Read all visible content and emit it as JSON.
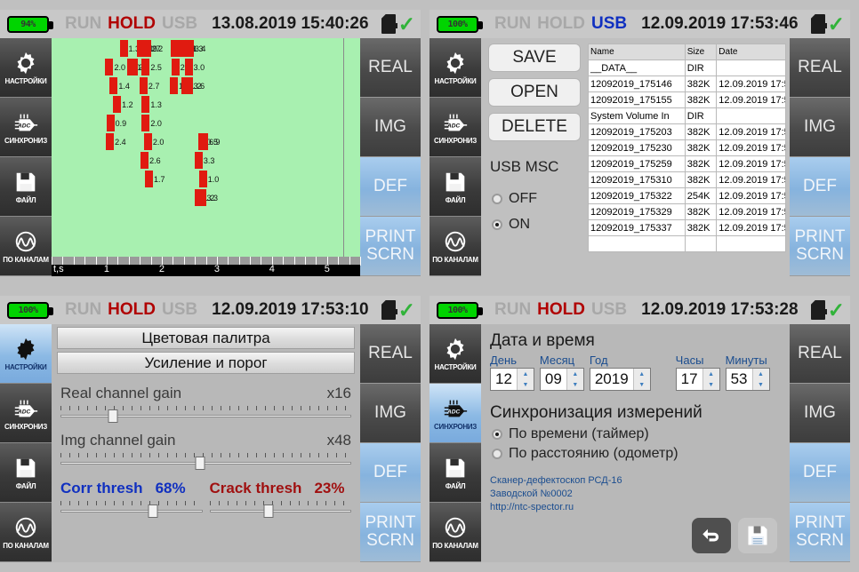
{
  "sidebar_items": [
    {
      "label": "НАСТРОЙКИ",
      "icon": "gear-icon"
    },
    {
      "label": "СИНХРОНИЗ",
      "icon": "adc-icon"
    },
    {
      "label": "ФАЙЛ",
      "icon": "floppy-icon"
    },
    {
      "label": "ПО КАНАЛАМ",
      "icon": "channels-icon"
    }
  ],
  "rail_items": [
    {
      "label": "REAL",
      "style": "dark"
    },
    {
      "label": "IMG",
      "style": "dark"
    },
    {
      "label": "DEF",
      "style": "blue"
    },
    {
      "label": "PRINT SCRN",
      "style": "blue"
    }
  ],
  "colors": {
    "chart_background": "#a8f0b0",
    "bar": "#e01b10",
    "hold": "#b00000",
    "usb": "#1030c0",
    "corr": "#1030c0",
    "crack": "#a01010",
    "battery": "#00d400",
    "check": "#31b33a",
    "active_sidebar": "#8bb9e4"
  },
  "panel1": {
    "header": {
      "battery": "94%",
      "run": "RUN",
      "hold": "HOLD",
      "usb": "USB",
      "datetime": "13.08.2019 15:40:26",
      "sd_icon": "sd-card-icon",
      "status_icon": "check-icon"
    },
    "active_sidebar_index": -1,
    "chart_data": {
      "type": "bar",
      "title": "",
      "xlabel": "t,s",
      "ylabel": "",
      "xlim": [
        0,
        5.6
      ],
      "xticks": [
        1,
        2,
        3,
        4,
        5
      ],
      "grid": false,
      "legend": null,
      "note": "Horizontal red defect-marker bars plotted over time; each bar carries a numeric depth label.",
      "bars": [
        {
          "x": 1.04,
          "row": 1,
          "value": "2.0"
        },
        {
          "x": 1.12,
          "row": 2,
          "value": "1.4"
        },
        {
          "x": 1.18,
          "row": 3,
          "value": "1.2"
        },
        {
          "x": 1.06,
          "row": 4,
          "value": "0.9"
        },
        {
          "x": 1.05,
          "row": 5,
          "value": "2.4"
        },
        {
          "x": 1.3,
          "row": 0,
          "value": "1.3"
        },
        {
          "x": 1.43,
          "row": 1,
          "value": "0.3"
        },
        {
          "x": 1.48,
          "row": 1,
          "value": "2.3"
        },
        {
          "x": 1.62,
          "row": 0,
          "value": "1.9"
        },
        {
          "x": 1.68,
          "row": 0,
          "value": "1.7"
        },
        {
          "x": 1.72,
          "row": 0,
          "value": "2.2"
        },
        {
          "x": 1.7,
          "row": 1,
          "value": "2.5"
        },
        {
          "x": 1.66,
          "row": 2,
          "value": "2.7"
        },
        {
          "x": 1.7,
          "row": 3,
          "value": "1.3"
        },
        {
          "x": 1.7,
          "row": 4,
          "value": "2.0"
        },
        {
          "x": 1.74,
          "row": 5,
          "value": "2.0"
        },
        {
          "x": 1.68,
          "row": 6,
          "value": "2.6"
        },
        {
          "x": 1.76,
          "row": 7,
          "value": "1.7"
        },
        {
          "x": 2.22,
          "row": 0,
          "value": "1.5"
        },
        {
          "x": 2.28,
          "row": 0,
          "value": "6.8"
        },
        {
          "x": 2.33,
          "row": 0,
          "value": "3.3"
        },
        {
          "x": 2.24,
          "row": 1,
          "value": "2.4"
        },
        {
          "x": 2.21,
          "row": 2,
          "value": "1.0"
        },
        {
          "x": 2.45,
          "row": 0,
          "value": "1.3"
        },
        {
          "x": 2.5,
          "row": 0,
          "value": "3.4"
        },
        {
          "x": 2.48,
          "row": 1,
          "value": "3.0"
        },
        {
          "x": 2.42,
          "row": 2,
          "value": "1.2"
        },
        {
          "x": 2.48,
          "row": 2,
          "value": "3.6"
        },
        {
          "x": 2.72,
          "row": 5,
          "value": "0.5"
        },
        {
          "x": 2.76,
          "row": 5,
          "value": "6.9"
        },
        {
          "x": 2.66,
          "row": 6,
          "value": "3.3"
        },
        {
          "x": 2.74,
          "row": 7,
          "value": "1.0"
        },
        {
          "x": 2.66,
          "row": 8,
          "value": "1.2"
        },
        {
          "x": 2.72,
          "row": 8,
          "value": "3.3"
        }
      ]
    }
  },
  "panel2": {
    "header": {
      "battery": "100%",
      "run": "RUN",
      "hold": "HOLD",
      "usb": "USB",
      "datetime": "12.09.2019 17:53:46",
      "sd_icon": "sd-card-icon",
      "status_icon": "check-icon"
    },
    "active_sidebar_index": -1,
    "buttons": [
      "SAVE",
      "OPEN",
      "DELETE"
    ],
    "usb_msc": {
      "title": "USB MSC",
      "options": [
        {
          "label": "OFF",
          "selected": false
        },
        {
          "label": "ON",
          "selected": true
        }
      ]
    },
    "file_table": {
      "columns": [
        "Name",
        "Size",
        "Date"
      ],
      "rows": [
        [
          "__DATA__",
          "DIR",
          ""
        ],
        [
          "12092019_175146",
          "382K",
          "12.09.2019 17:5"
        ],
        [
          "12092019_175155",
          "382K",
          "12.09.2019 17:5"
        ],
        [
          "System Volume In",
          "DIR",
          ""
        ],
        [
          "12092019_175203",
          "382K",
          "12.09.2019 17:5"
        ],
        [
          "12092019_175230",
          "382K",
          "12.09.2019 17:5"
        ],
        [
          "12092019_175259",
          "382K",
          "12.09.2019 17:5"
        ],
        [
          "12092019_175310",
          "382K",
          "12.09.2019 17:5"
        ],
        [
          "12092019_175322",
          "254K",
          "12.09.2019 17:5"
        ],
        [
          "12092019_175329",
          "382K",
          "12.09.2019 17:5"
        ],
        [
          "12092019_175337",
          "382K",
          "12.09.2019 17:5"
        ],
        [
          "",
          "",
          ""
        ]
      ]
    }
  },
  "panel3": {
    "header": {
      "battery": "100%",
      "run": "RUN",
      "hold": "HOLD",
      "usb": "USB",
      "datetime": "12.09.2019 17:53:10",
      "sd_icon": "sd-card-icon",
      "status_icon": "check-icon"
    },
    "active_sidebar_index": 0,
    "menu": [
      "Цветовая палитра",
      "Усиление и порог"
    ],
    "gains": [
      {
        "name": "Real channel gain",
        "value": "x16",
        "knob_pct": 18
      },
      {
        "name": "Img channel gain",
        "value": "x48",
        "knob_pct": 48
      }
    ],
    "thresholds": [
      {
        "name": "Corr thresh",
        "value": "68%",
        "knob_pct": 65
      },
      {
        "name": "Crack thresh",
        "value": "23%",
        "knob_pct": 42
      }
    ]
  },
  "panel4": {
    "header": {
      "battery": "100%",
      "run": "RUN",
      "hold": "HOLD",
      "usb": "USB",
      "datetime": "12.09.2019 17:53:28",
      "sd_icon": "sd-card-icon",
      "status_icon": "check-icon"
    },
    "active_sidebar_index": 1,
    "datetime_title": "Дата и время",
    "fields": [
      {
        "label": "День",
        "value": "12"
      },
      {
        "label": "Месяц",
        "value": "09"
      },
      {
        "label": "Год",
        "value": "2019"
      },
      {
        "label": "Часы",
        "value": "17"
      },
      {
        "label": "Минуты",
        "value": "53"
      }
    ],
    "sync_title": "Синхронизация измерений",
    "sync_options": [
      {
        "label": "По времени (таймер)",
        "selected": true
      },
      {
        "label": "По расстоянию (одометр)",
        "selected": false
      }
    ],
    "info_lines": [
      "Сканер-дефектоскоп РСД-16",
      "Заводской №0002",
      "http://ntc-spector.ru"
    ],
    "actions": [
      {
        "name": "undo-button",
        "icon": "undo-arrow-icon"
      },
      {
        "name": "save-button",
        "icon": "floppy-icon"
      }
    ]
  }
}
